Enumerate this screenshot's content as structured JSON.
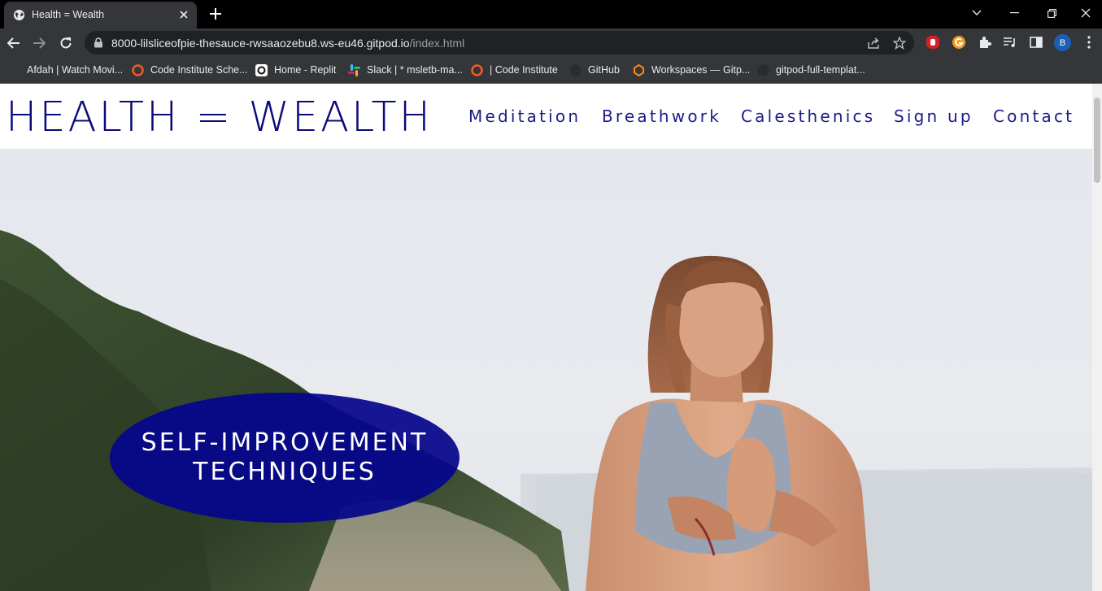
{
  "browser": {
    "tab_title": "Health = Wealth",
    "url_host": "8000-lilsliceofpie-thesauce-rwsaaozebu8.ws-eu46.gitpod.io",
    "url_path": "/index.html",
    "profile_initial": "B"
  },
  "bookmarks": [
    {
      "label": "Afdah | Watch Movi...",
      "icon": "blank-icon"
    },
    {
      "label": "Code Institute Sche...",
      "icon": "code-institute-icon"
    },
    {
      "label": "Home - Replit",
      "icon": "replit-icon"
    },
    {
      "label": "Slack | * msletb-ma...",
      "icon": "slack-icon"
    },
    {
      "label": "| Code Institute",
      "icon": "code-institute-icon"
    },
    {
      "label": "GitHub",
      "icon": "github-icon"
    },
    {
      "label": "Workspaces — Gitp...",
      "icon": "gitpod-icon"
    },
    {
      "label": "gitpod-full-templat...",
      "icon": "github-icon"
    }
  ],
  "site": {
    "logo": "HEALTH = WEALTH",
    "nav": [
      "Meditation",
      "Breathwork",
      "Calesthenics",
      "Sign up",
      "Contact"
    ],
    "hero_title_line1": "SELF-IMPROVEMENT",
    "hero_title_line2": "TECHNIQUES"
  },
  "colors": {
    "brand": "#0a0a7a",
    "badge": "#05058c",
    "chrome_dark": "#35363a"
  }
}
